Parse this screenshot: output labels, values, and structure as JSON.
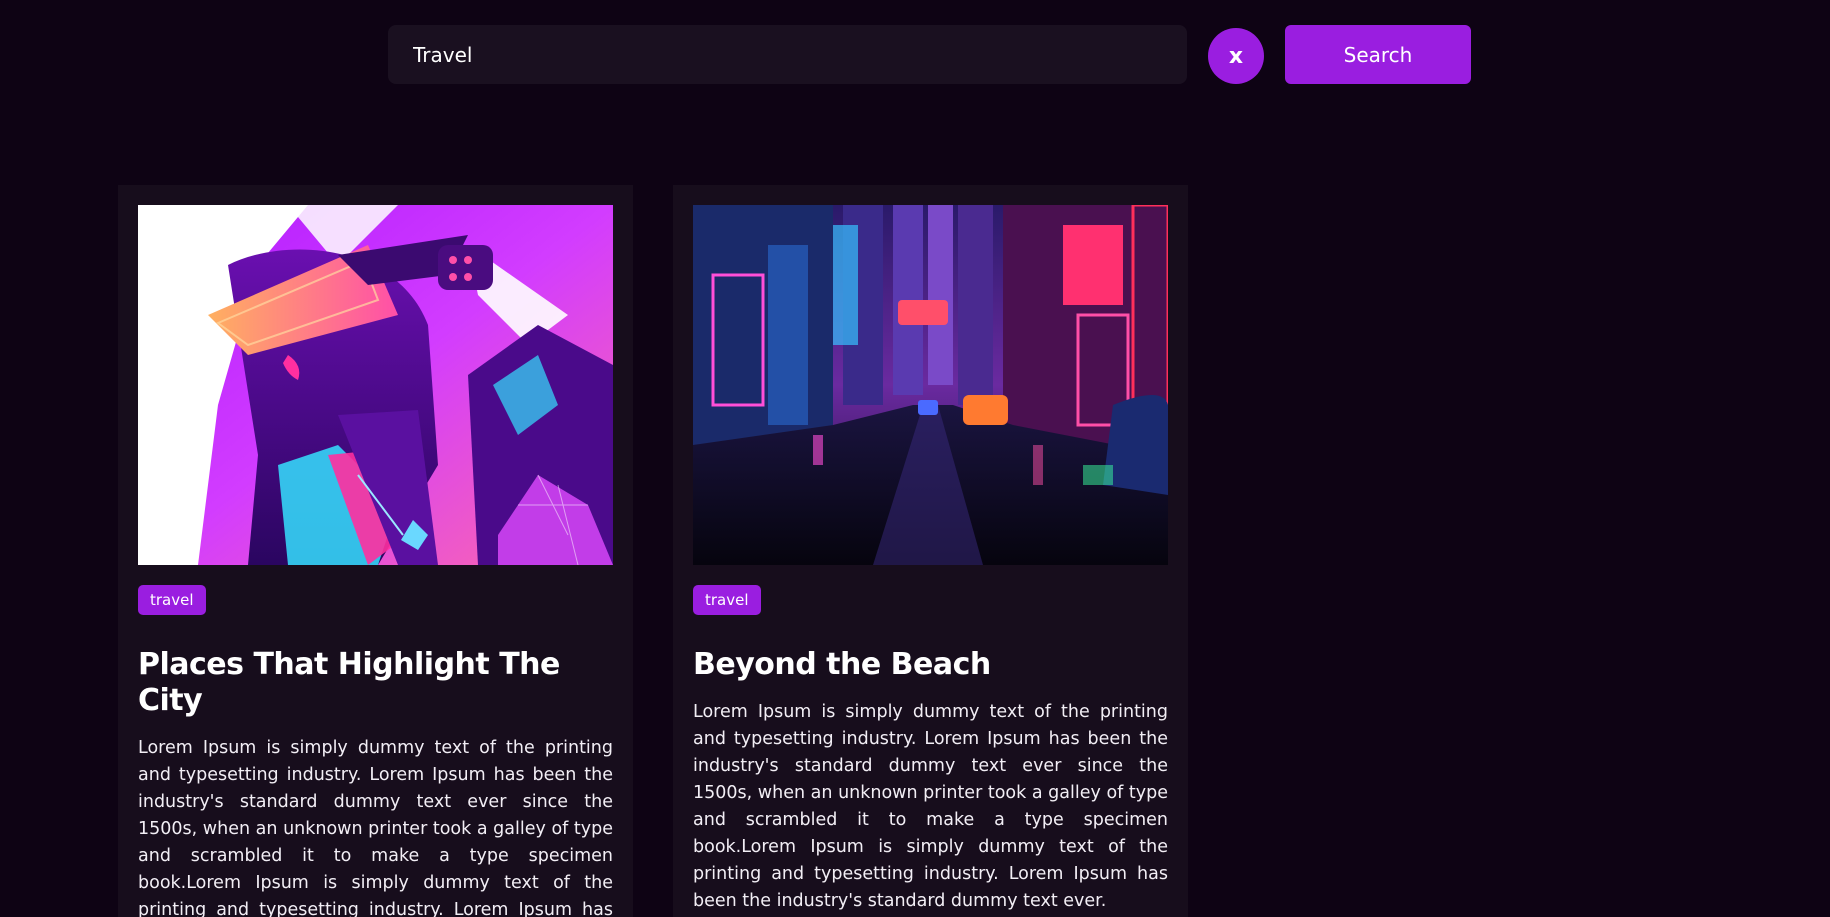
{
  "search": {
    "value": "Travel",
    "clear_label": "x",
    "button_label": "Search"
  },
  "colors": {
    "background": "#0e0314",
    "card": "#170d1c",
    "accent": "#9a1ee0"
  },
  "posts": [
    {
      "tag": "travel",
      "title": "Places That Highlight The City",
      "body": "Lorem Ipsum is simply dummy text of the printing and typesetting industry. Lorem Ipsum has been the industry's standard dummy text ever since the 1500s, when an unknown printer took a galley of type and scrambled it to make a type specimen book.Lorem Ipsum is simply dummy text of the printing and typesetting industry. Lorem Ipsum has been the industry's standard dummy text ever."
    },
    {
      "tag": "travel",
      "title": "Beyond the Beach",
      "body": "Lorem Ipsum is simply dummy text of the printing and typesetting industry. Lorem Ipsum has been the industry's standard dummy text ever since the 1500s, when an unknown printer took a galley of type and scrambled it to make a type specimen book.Lorem Ipsum is simply dummy text of the printing and typesetting industry. Lorem Ipsum has been the industry's standard dummy text ever."
    }
  ]
}
